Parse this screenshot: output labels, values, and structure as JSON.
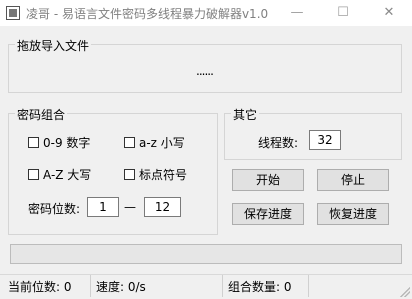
{
  "window": {
    "title": "凌哥 - 易语言文件密码多线程暴力破解器v1.0",
    "minimize_glyph": "—",
    "maximize_glyph": "☐",
    "close_glyph": "✕"
  },
  "import": {
    "group_title": "拖放导入文件",
    "placeholder": "......"
  },
  "combo": {
    "group_title": "密码组合",
    "digits_label": "0-9 数字",
    "lower_label": "a-z 小写",
    "upper_label": "A-Z 大写",
    "symbols_label": "标点符号",
    "length_label": "密码位数:",
    "length_min": "1",
    "length_dash": "—",
    "length_max": "12"
  },
  "other": {
    "group_title": "其它",
    "threads_label": "线程数:",
    "threads_value": "32"
  },
  "buttons": {
    "start": "开始",
    "stop": "停止",
    "save": "保存进度",
    "restore": "恢复进度"
  },
  "progress": {
    "value": 0
  },
  "status": {
    "current_length": "当前位数: 0",
    "speed": "速度: 0/s",
    "combinations": "组合数量: 0"
  }
}
